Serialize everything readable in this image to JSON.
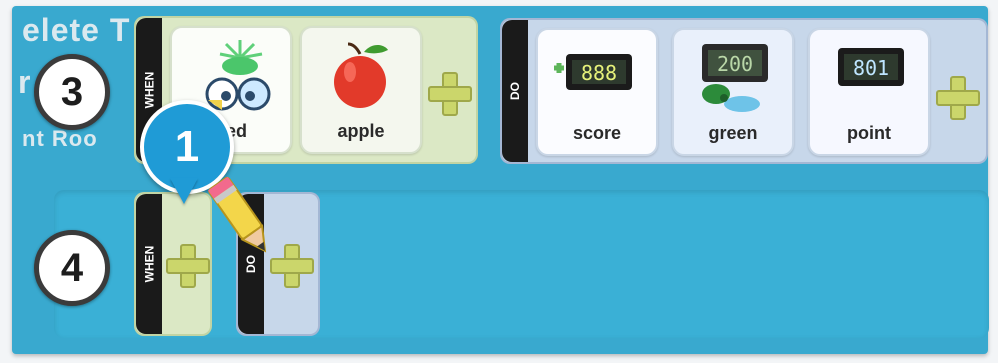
{
  "header_fragment": "elete T",
  "left_fragment": "r",
  "sub_fragment": "nt Roo",
  "rows": {
    "row3": {
      "number": "3",
      "when_label": "WHEN",
      "do_label": "DO",
      "when_cards": [
        "ped",
        "apple"
      ],
      "do_cards": [
        "score",
        "green",
        "point"
      ]
    },
    "row4": {
      "number": "4",
      "when_label": "WHEN",
      "do_label": "DO"
    }
  },
  "step_badge": "1",
  "icons": {
    "add_rule": "plus-icon",
    "edit": "pencil-icon",
    "tapped_sensor": "tapped-eyes-icon",
    "apple": "apple-icon",
    "score_display": "score-counter-icon",
    "green_flag": "green-counter-icon",
    "point_display": "point-counter-icon"
  },
  "colors": {
    "panel": "#39a9cf",
    "when_bg": "#dbe8c5",
    "do_bg": "#c7d7ea",
    "strip": "#1a1a1a",
    "plus": "#cbd66b",
    "badge": "#1f9bd6"
  }
}
